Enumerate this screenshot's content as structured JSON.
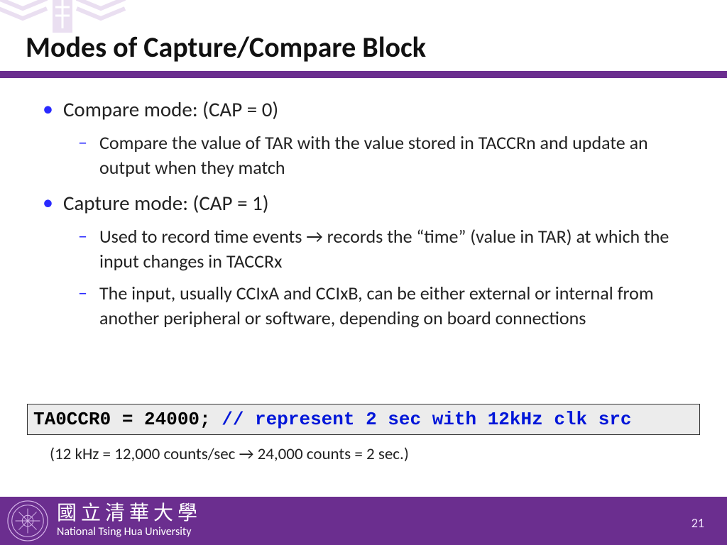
{
  "slide": {
    "title": "Modes of Capture/Compare Block",
    "bullets": [
      {
        "text": "Compare mode: (CAP = 0)",
        "children": [
          "Compare the value of TAR with the value stored in TACCRn and update an output when they match"
        ]
      },
      {
        "text": "Capture mode: (CAP = 1)",
        "children": [
          "Used to record time events → records the “time” (value in TAR) at which the input changes in TACCRx",
          "The input, usually CCIxA and CCIxB, can be either external or internal from another peripheral or software, depending on board connections"
        ]
      }
    ],
    "code": {
      "stmt": "TA0CCR0 = 24000;",
      "comment": " // represent 2 sec with 12kHz clk src"
    },
    "calc_note": "(12 kHz = 12,000 counts/sec → 24,000 counts = 2 sec.)"
  },
  "footer": {
    "university_zh": "國立清華大學",
    "university_en": "National Tsing Hua University",
    "page_number": "21"
  },
  "markers": {
    "dash": "–",
    "bullet": "•"
  }
}
